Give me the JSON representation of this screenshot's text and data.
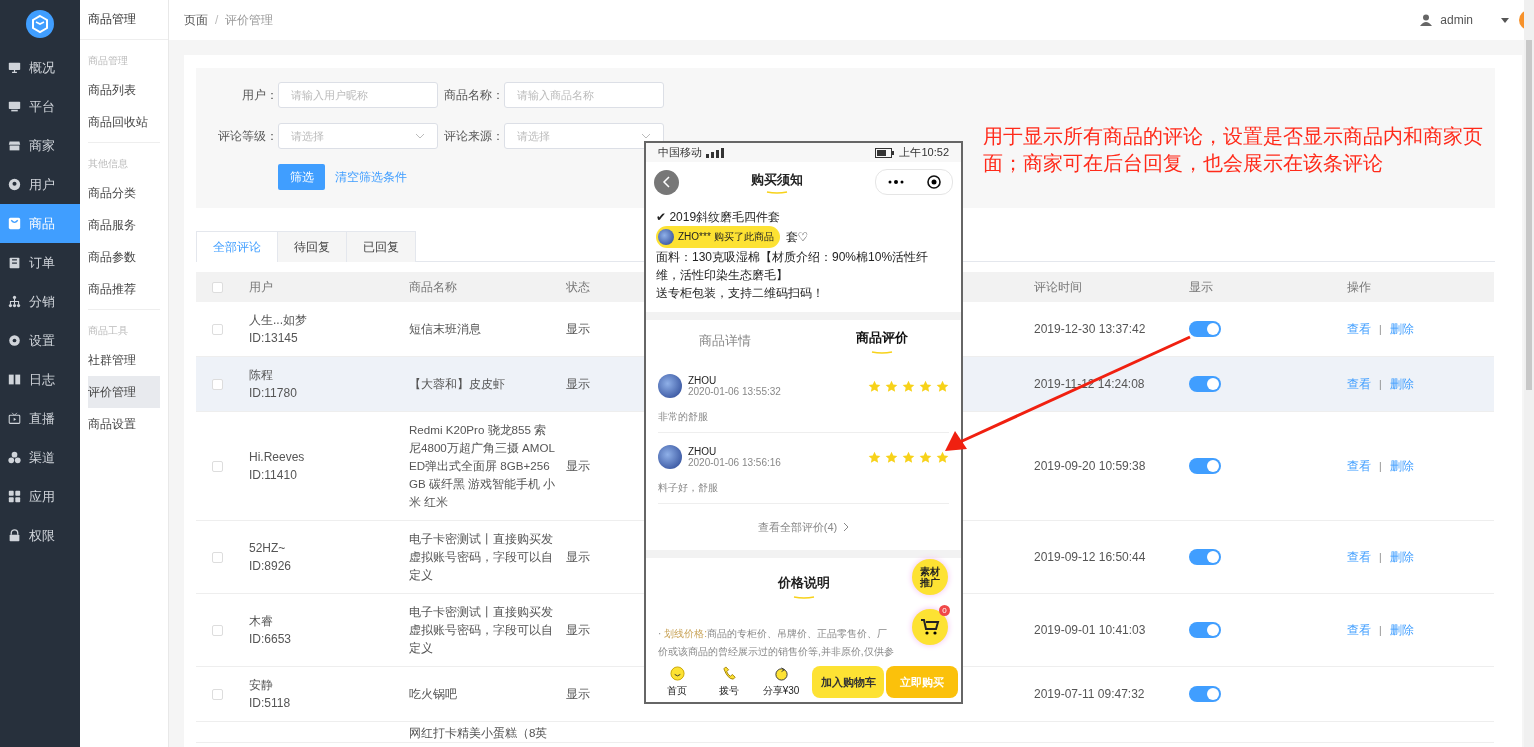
{
  "sidebar": {
    "items": [
      {
        "label": "概况",
        "selected": false
      },
      {
        "label": "平台",
        "selected": false
      },
      {
        "label": "商家",
        "selected": false
      },
      {
        "label": "用户",
        "selected": false
      },
      {
        "label": "商品",
        "selected": true
      },
      {
        "label": "订单",
        "selected": false
      },
      {
        "label": "分销",
        "selected": false
      },
      {
        "label": "设置",
        "selected": false
      },
      {
        "label": "日志",
        "selected": false
      },
      {
        "label": "直播",
        "selected": false
      },
      {
        "label": "渠道",
        "selected": false
      },
      {
        "label": "应用",
        "selected": false
      },
      {
        "label": "权限",
        "selected": false
      }
    ]
  },
  "submenu": {
    "title": "商品管理",
    "groups": [
      {
        "heading": "商品管理",
        "items": [
          {
            "label": "商品列表",
            "selected": false
          },
          {
            "label": "商品回收站",
            "selected": false
          }
        ]
      },
      {
        "heading": "其他信息",
        "items": [
          {
            "label": "商品分类",
            "selected": false
          },
          {
            "label": "商品服务",
            "selected": false
          },
          {
            "label": "商品参数",
            "selected": false
          },
          {
            "label": "商品推荐",
            "selected": false
          }
        ]
      },
      {
        "heading": "商品工具",
        "items": [
          {
            "label": "社群管理",
            "selected": false
          },
          {
            "label": "评价管理",
            "selected": true
          },
          {
            "label": "商品设置",
            "selected": false
          }
        ]
      }
    ]
  },
  "header": {
    "breadcrumb": [
      "页面",
      "评价管理"
    ],
    "separator": "/",
    "user": "admin"
  },
  "filters": {
    "fields": [
      {
        "label": "用户：",
        "placeholder": "请输入用户昵称",
        "kind": "input"
      },
      {
        "label": "商品名称：",
        "placeholder": "请输入商品名称",
        "kind": "input"
      },
      {
        "label": "评论等级：",
        "placeholder": "请选择",
        "kind": "select"
      },
      {
        "label": "评论来源：",
        "placeholder": "请选择",
        "kind": "select"
      }
    ],
    "submit": "筛选",
    "clear": "清空筛选条件"
  },
  "tabs": [
    {
      "label": "全部评论",
      "selected": true
    },
    {
      "label": "待回复",
      "selected": false
    },
    {
      "label": "已回复",
      "selected": false
    }
  ],
  "table": {
    "select_all_checked": false,
    "action_separator": "|",
    "columns": [
      "用户",
      "商品名称",
      "状态",
      "评论时间",
      "显示",
      "操作"
    ],
    "rows": [
      {
        "checked": false,
        "highlighted": false,
        "user": "人生...如梦",
        "user_id": "ID:13145",
        "product": "短信末班消息",
        "status": "显示",
        "time": "2019-12-30 13:37:42",
        "shown": true,
        "actions": [
          "查看",
          "删除"
        ]
      },
      {
        "checked": false,
        "highlighted": true,
        "user": "陈程",
        "user_id": "ID:11780",
        "product": "【大蓉和】皮皮虾",
        "status": "显示",
        "time": "2019-11-12 14:24:08",
        "shown": true,
        "actions": [
          "查看",
          "删除"
        ]
      },
      {
        "checked": false,
        "highlighted": false,
        "user": "Hi.Reeves",
        "user_id": "ID:11410",
        "product": "Redmi K20Pro 骁龙855 索尼4800万超广角三摄 AMOLED弹出式全面屏 8GB+256GB 碳纤黑 游戏智能手机 小米 红米",
        "status": "显示",
        "time": "2019-09-20 10:59:38",
        "shown": true,
        "actions": [
          "查看",
          "删除"
        ]
      },
      {
        "checked": false,
        "highlighted": false,
        "user": "52HZ~",
        "user_id": "ID:8926",
        "product": "电子卡密测试丨直接购买发虚拟账号密码，字段可以自定义",
        "status": "显示",
        "time": "2019-09-12 16:50:44",
        "shown": true,
        "actions": [
          "查看",
          "删除"
        ]
      },
      {
        "checked": false,
        "highlighted": false,
        "user": "木睿",
        "user_id": "ID:6653",
        "product": "电子卡密测试丨直接购买发虚拟账号密码，字段可以自定义",
        "status": "显示",
        "time": "2019-09-01 10:41:03",
        "shown": true,
        "actions": [
          "查看",
          "删除"
        ]
      },
      {
        "checked": false,
        "highlighted": false,
        "user": "安静",
        "user_id": "ID:5118",
        "product": "吃火锅吧",
        "status": "显示",
        "time": "2019-07-11 09:47:32",
        "shown": true
      },
      {
        "product": "网红打卡精美小蛋糕（8英"
      }
    ]
  },
  "annotation": "用于显示所有商品的评论，设置是否显示商品内和商家页面；商家可在后台回复，也会展示在该条评论",
  "phone": {
    "carrier": "中国移动",
    "clock": "上午10:52",
    "title": "购买须知",
    "description": [
      "✔ 2019斜纹磨毛四件套",
      "面料：130克吸湿棉【材质介绍：90%棉10%活性纤维，活性印染生态磨毛】",
      "送专柜包装，支持二维码扫码！"
    ],
    "toast": "ZHO*** 购买了此商品",
    "toast_tail": "套♡",
    "tabs": [
      {
        "label": "商品详情",
        "selected": false
      },
      {
        "label": "商品评价",
        "selected": true
      }
    ],
    "reviews": [
      {
        "name": "ZHOU",
        "date": "2020-01-06 13:55:32",
        "stars": 5,
        "comment": "非常的舒服"
      },
      {
        "name": "ZHOU",
        "date": "2020-01-06 13:56:16",
        "stars": 5,
        "comment": "料子好，舒服"
      }
    ],
    "more": "查看全部评价(4)",
    "section_title": "价格说明",
    "price_note": {
      "bullet": "·",
      "term": "划线价格:",
      "text": "商品的专柜价、吊牌价、正品零售价、厂",
      "line2": "价或该商品的曾经展示过的销售价等,并非原价,仅供参"
    },
    "promo": "素材推广",
    "cart_badge": "0",
    "nav": [
      {
        "label": "首页"
      },
      {
        "label": "拨号"
      },
      {
        "label": "分享¥30"
      }
    ],
    "buttons": [
      {
        "label": "加入购物车",
        "kind": "add"
      },
      {
        "label": "立即购买",
        "kind": "buy"
      }
    ]
  }
}
